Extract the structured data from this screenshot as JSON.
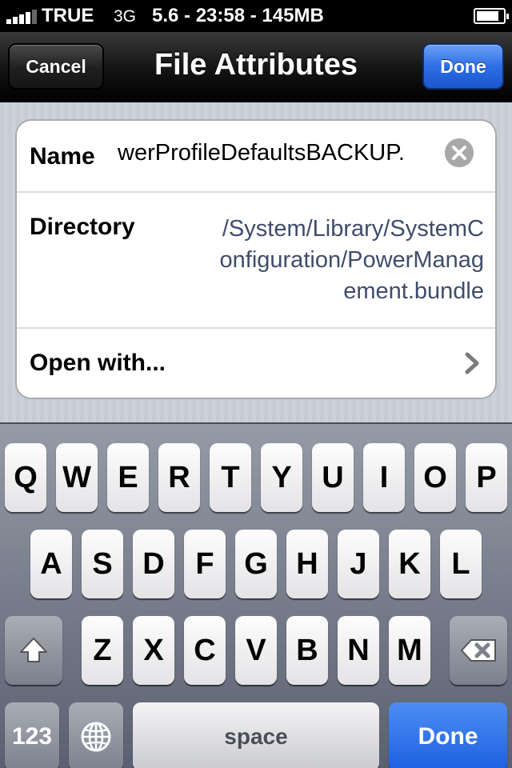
{
  "status_bar": {
    "carrier": "TRUE",
    "network": "3G",
    "info": "5.6 - 23:58 - 145MB",
    "signal_bars": 4,
    "battery_level": 0.85
  },
  "nav": {
    "cancel_label": "Cancel",
    "title": "File Attributes",
    "done_label": "Done"
  },
  "form": {
    "name_label": "Name",
    "name_value": "werProfileDefaultsBACKUP.",
    "directory_label": "Directory",
    "directory_lines": [
      "/System/Library/SystemC",
      "onfiguration/PowerManag",
      "ement.bundle"
    ],
    "open_with_label": "Open with..."
  },
  "keyboard": {
    "row1": [
      "Q",
      "W",
      "E",
      "R",
      "T",
      "Y",
      "U",
      "I",
      "O",
      "P"
    ],
    "row2": [
      "A",
      "S",
      "D",
      "F",
      "G",
      "H",
      "J",
      "K",
      "L"
    ],
    "row3": [
      "Z",
      "X",
      "C",
      "V",
      "B",
      "N",
      "M"
    ],
    "numbers_label": "123",
    "space_label": "space",
    "done_label": "Done"
  },
  "colors": {
    "nav_done_blue": "#2e6ee6",
    "value_text": "#3f4c6b",
    "keyboard_bg": "#6c7280"
  }
}
